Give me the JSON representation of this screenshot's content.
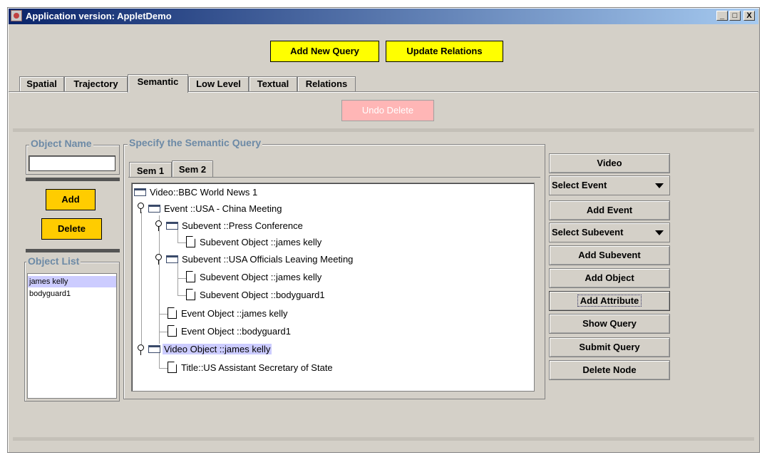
{
  "window": {
    "title": "Application version: AppletDemo",
    "controls": [
      "_",
      "□",
      "X"
    ]
  },
  "toolbar": {
    "add_new_query": "Add New Query",
    "update_relations": "Update Relations"
  },
  "tabs": [
    "Spatial",
    "Trajectory",
    "Semantic",
    "Low Level",
    "Textual",
    "Relations"
  ],
  "active_tab": "Semantic",
  "undo_delete": "Undo Delete",
  "object_name": {
    "title": "Object Name",
    "value": ""
  },
  "object_buttons": {
    "add": "Add",
    "delete": "Delete"
  },
  "object_list": {
    "title": "Object List",
    "items": [
      "james kelly",
      "bodyguard1"
    ],
    "selected": "james kelly"
  },
  "semantic_query": {
    "title": "Specify the Semantic Query",
    "sem_tabs": [
      "Sem 1",
      "Sem 2"
    ],
    "tree": [
      "Video::BBC World News 1",
      "Event ::USA - China Meeting",
      "Subevent ::Press Conference",
      "Subevent Object ::james kelly",
      "Subevent ::USA Officials Leaving Meeting",
      "Subevent Object ::james kelly",
      "Subevent Object ::bodyguard1",
      "Event Object ::james kelly",
      "Event Object ::bodyguard1",
      "Video Object ::james kelly",
      "Title::US Assistant Secretary of State"
    ],
    "selected_node": "Video Object ::james kelly"
  },
  "right_panel": {
    "video": "Video",
    "select_event": "Select Event",
    "add_event": "Add Event",
    "select_subevent": "Select Subevent",
    "add_subevent": "Add Subevent",
    "add_object": "Add Object",
    "add_attribute": "Add Attribute",
    "show_query": "Show Query",
    "submit_query": "Submit Query",
    "delete_node": "Delete Node"
  },
  "colors": {
    "accent_yellow": "#ffff00",
    "button_orange": "#ffcc00",
    "undo_pink": "#ffb6b6",
    "selection": "#ccccff",
    "title_blue": "#0a246a"
  }
}
